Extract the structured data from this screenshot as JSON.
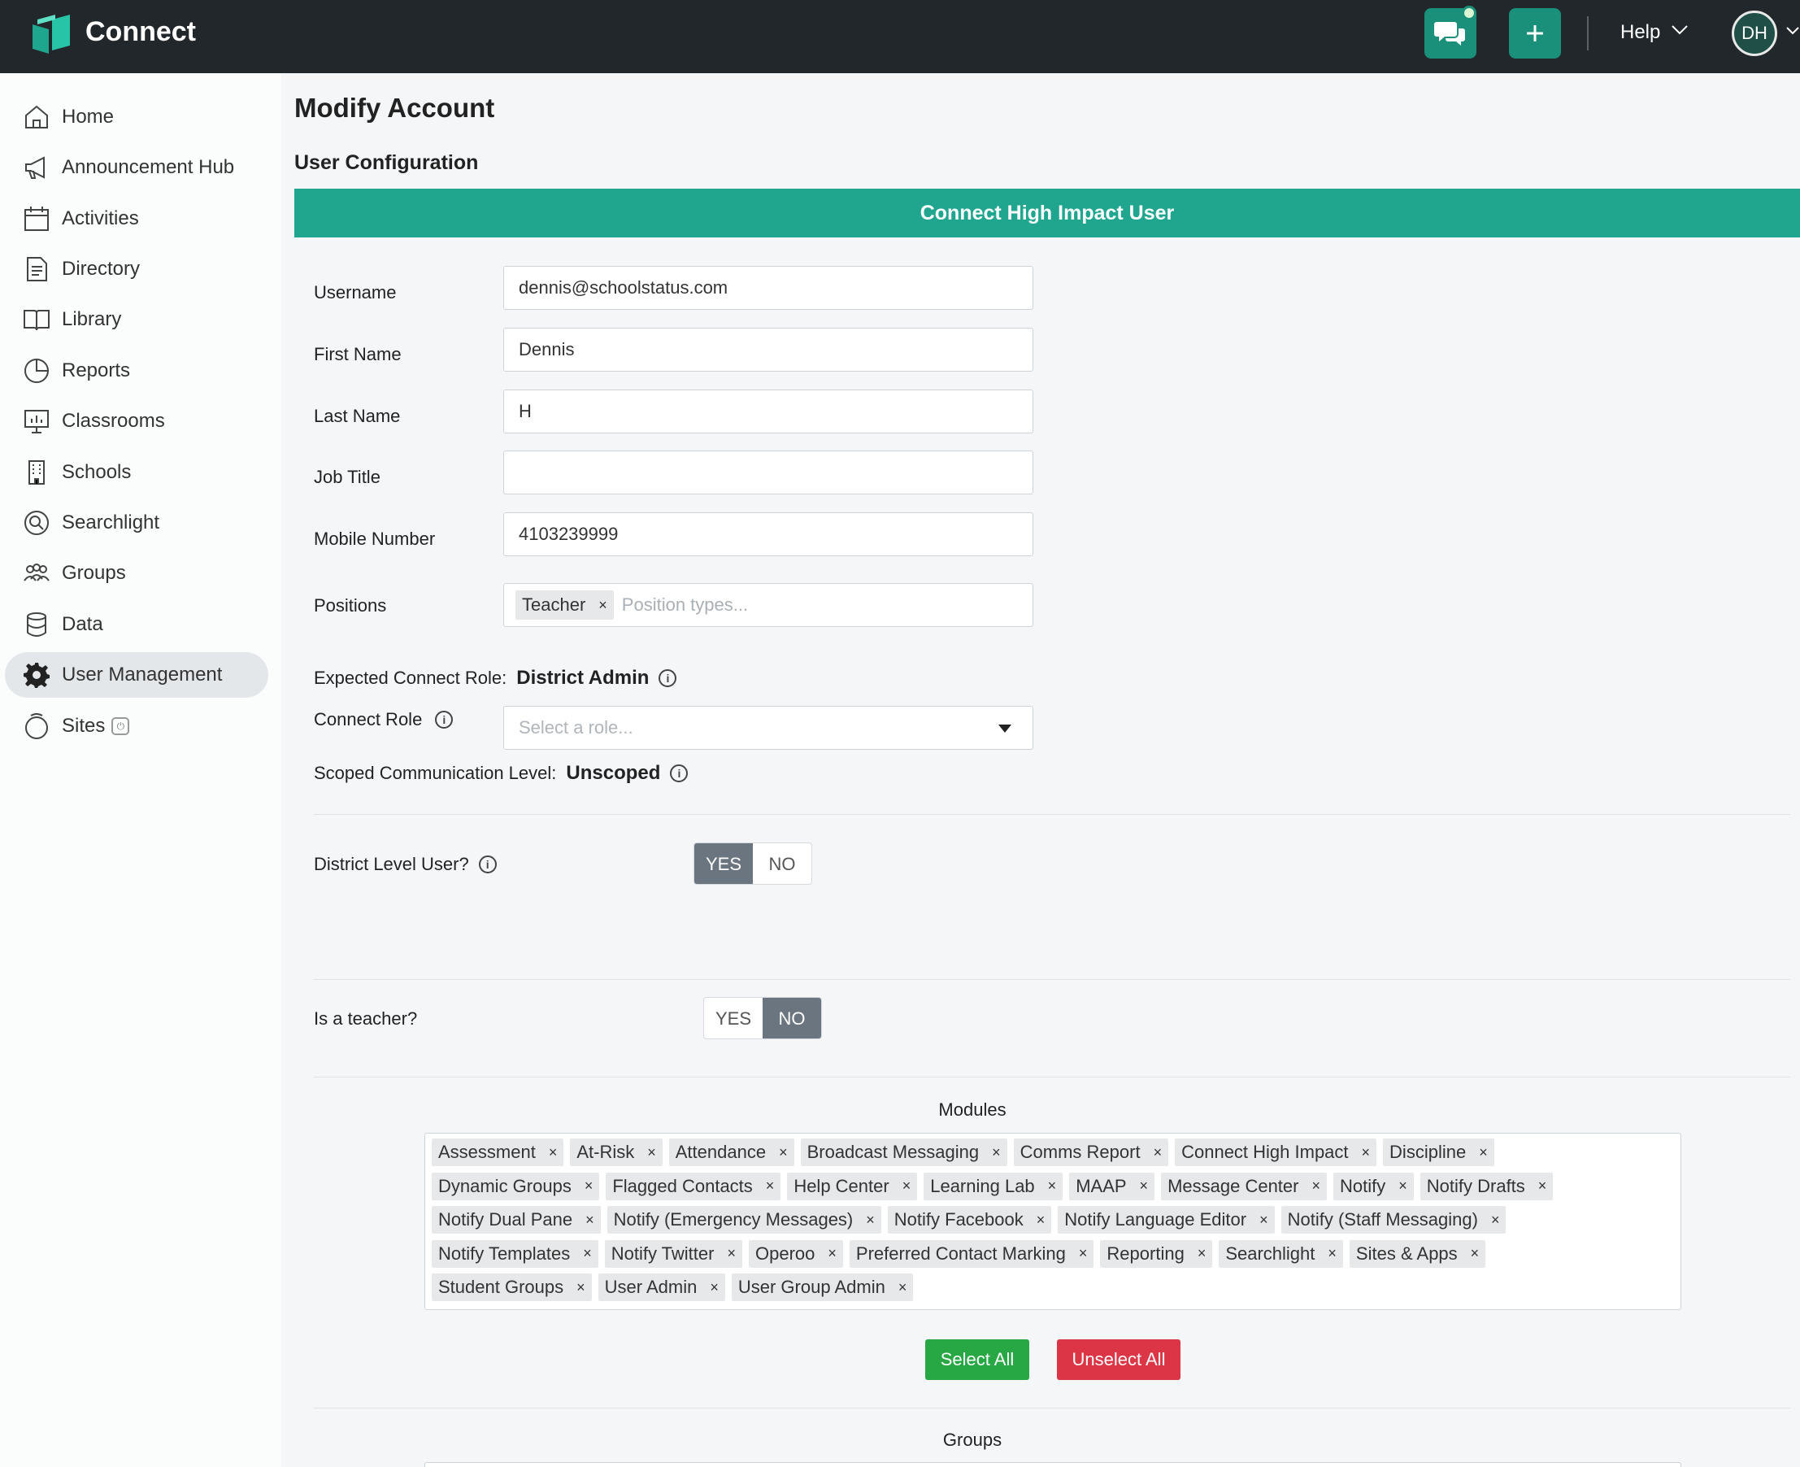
{
  "app": {
    "name": "Connect",
    "help_label": "Help",
    "avatar_initials": "DH"
  },
  "sidebar": {
    "items": [
      {
        "label": "Home",
        "icon": "home-icon"
      },
      {
        "label": "Announcement Hub",
        "icon": "megaphone-icon"
      },
      {
        "label": "Activities",
        "icon": "calendar-icon"
      },
      {
        "label": "Directory",
        "icon": "document-icon"
      },
      {
        "label": "Library",
        "icon": "book-icon"
      },
      {
        "label": "Reports",
        "icon": "pie-chart-icon"
      },
      {
        "label": "Classrooms",
        "icon": "presentation-icon"
      },
      {
        "label": "Schools",
        "icon": "building-icon"
      },
      {
        "label": "Searchlight",
        "icon": "searchlight-icon"
      },
      {
        "label": "Groups",
        "icon": "people-icon"
      },
      {
        "label": "Data",
        "icon": "database-icon"
      },
      {
        "label": "User Management",
        "icon": "gear-icon",
        "active": true
      },
      {
        "label": "Sites",
        "icon": "sites-icon"
      }
    ]
  },
  "page": {
    "title": "Modify Account",
    "section_title": "User Configuration",
    "banner": "Connect High Impact User"
  },
  "form": {
    "username": {
      "label": "Username",
      "value": "dennis@schoolstatus.com"
    },
    "first_name": {
      "label": "First Name",
      "value": "Dennis"
    },
    "last_name": {
      "label": "Last Name",
      "value": "H"
    },
    "job_title": {
      "label": "Job Title",
      "value": ""
    },
    "mobile": {
      "label": "Mobile Number",
      "value": "4103239999"
    },
    "positions": {
      "label": "Positions",
      "tags": [
        "Teacher"
      ],
      "placeholder": "Position types..."
    },
    "expected_role": {
      "label": "Expected Connect Role:",
      "value": "District Admin"
    },
    "connect_role": {
      "label": "Connect Role",
      "placeholder": "Select a role..."
    },
    "scoped_level": {
      "label": "Scoped Communication Level:",
      "value": "Unscoped"
    },
    "district_level": {
      "label": "District Level User?",
      "yes": "YES",
      "no": "NO",
      "selected": "YES"
    },
    "is_teacher": {
      "label": "Is a teacher?",
      "yes": "YES",
      "no": "NO",
      "selected": "NO"
    }
  },
  "modules": {
    "title": "Modules",
    "rows": [
      [
        "Assessment",
        "At-Risk",
        "Attendance",
        "Broadcast Messaging",
        "Comms Report",
        "Connect High Impact",
        "Discipline"
      ],
      [
        "Dynamic Groups",
        "Flagged Contacts",
        "Help Center",
        "Learning Lab",
        "MAAP",
        "Message Center",
        "Notify",
        "Notify Drafts"
      ],
      [
        "Notify Dual Pane",
        "Notify (Emergency Messages)",
        "Notify Facebook",
        "Notify Language Editor",
        "Notify (Staff Messaging)"
      ],
      [
        "Notify Templates",
        "Notify Twitter",
        "Operoo",
        "Preferred Contact Marking",
        "Reporting",
        "Searchlight",
        "Sites & Apps"
      ],
      [
        "Student Groups",
        "User Admin",
        "User Group Admin"
      ]
    ],
    "remove_glyph": "×",
    "select_all": "Select All",
    "unselect_all": "Unselect All"
  },
  "groups": {
    "title": "Groups"
  },
  "colors": {
    "topbar": "#22272b",
    "accent": "#20a68f",
    "success": "#28a745",
    "danger": "#dc3545"
  }
}
